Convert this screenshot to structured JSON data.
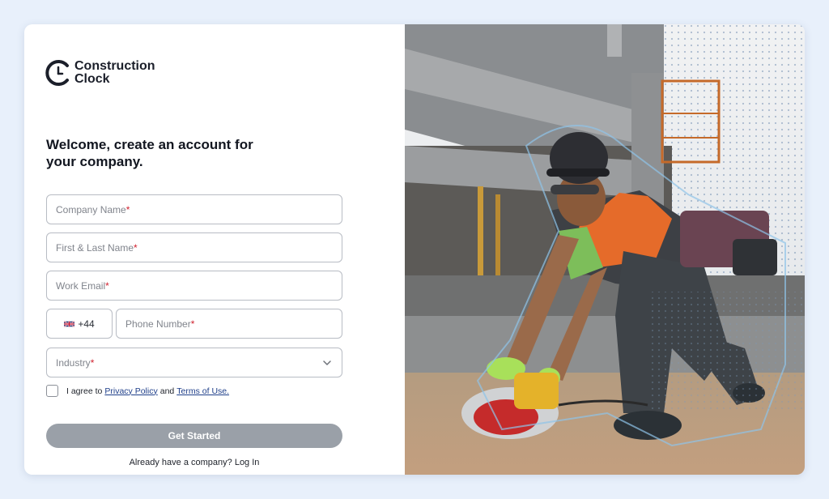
{
  "brand": {
    "line1": "Construction",
    "line2": "Clock"
  },
  "heading": "Welcome, create an account for your company.",
  "form": {
    "company_name": {
      "placeholder": "Company Name",
      "required": "*"
    },
    "full_name": {
      "placeholder": "First & Last Name",
      "required": "*"
    },
    "work_email": {
      "placeholder": "Work Email",
      "required": "*"
    },
    "country_code": {
      "value": "+44",
      "flag": "uk-flag-icon"
    },
    "phone": {
      "placeholder": "Phone Number",
      "required": "*"
    },
    "industry": {
      "placeholder": "Industry",
      "required": "*",
      "icon": "chevron-down-icon"
    }
  },
  "agree": {
    "prefix": "I agree to",
    "privacy_link": "Privacy Policy",
    "and": "and",
    "terms_link": "Terms of Use."
  },
  "cta": "Get Started",
  "login_prompt": "Already have a company? Log In",
  "colors": {
    "background": "#e8f0fb",
    "button": "#9aa0a8",
    "required": "#d0212f",
    "link": "#1f3f8a"
  }
}
